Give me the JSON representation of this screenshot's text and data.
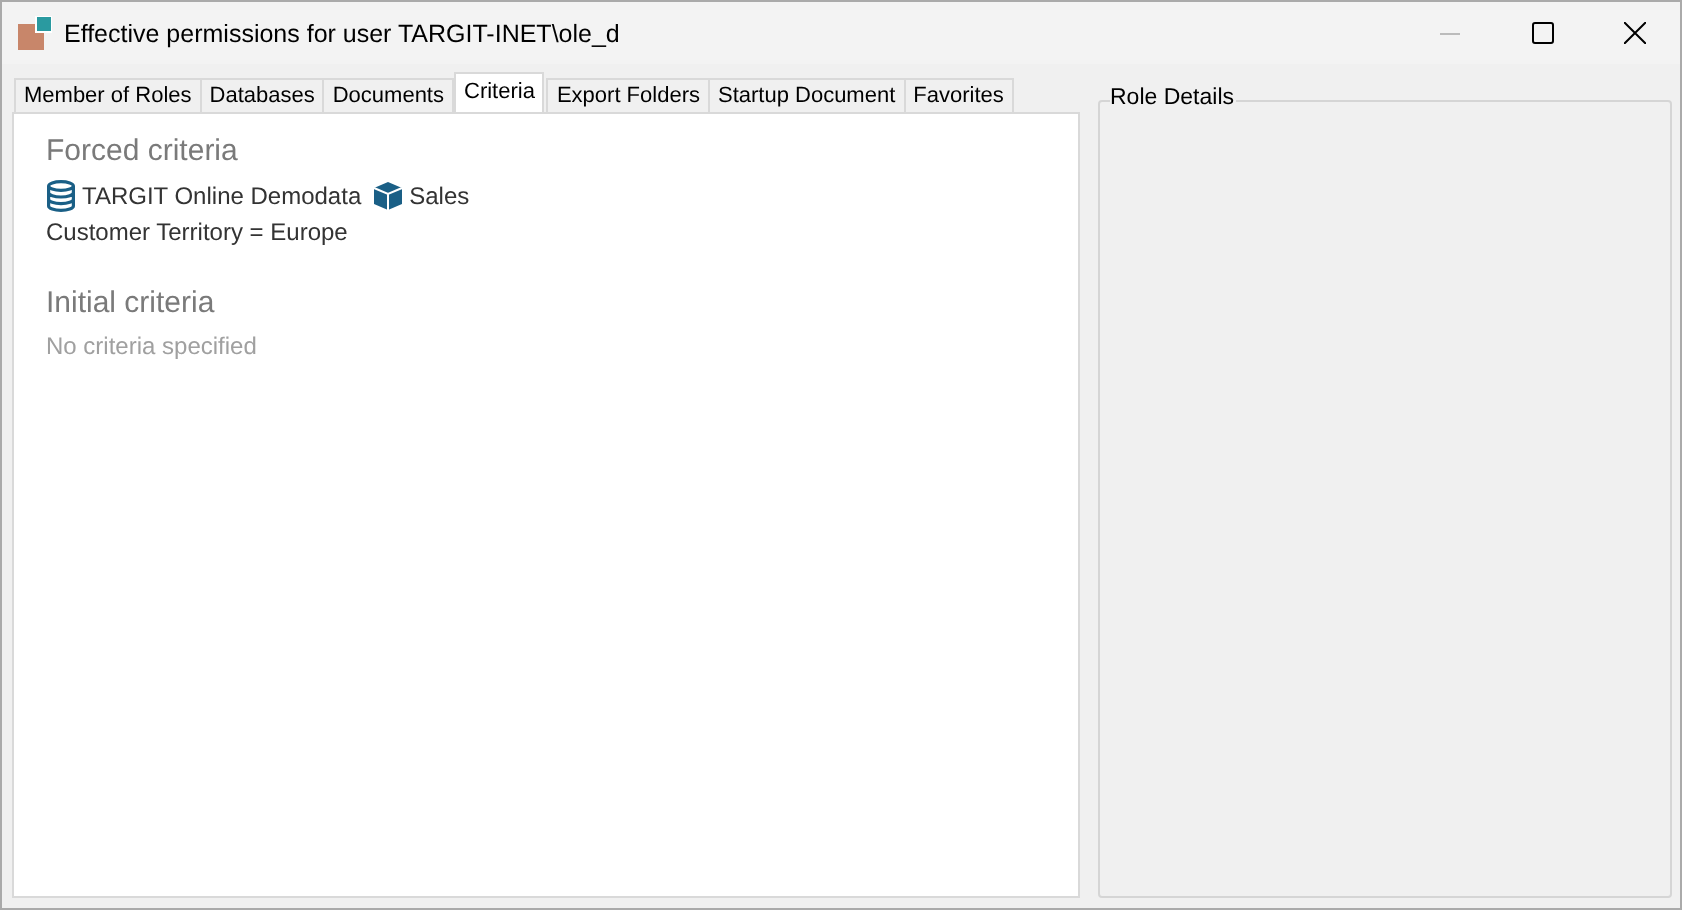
{
  "window": {
    "title": "Effective permissions for user TARGIT-INET\\ole_d"
  },
  "tabs": [
    {
      "label": "Member of Roles",
      "selected": false
    },
    {
      "label": "Databases",
      "selected": false
    },
    {
      "label": "Documents",
      "selected": false
    },
    {
      "label": "Criteria",
      "selected": true
    },
    {
      "label": "Export Folders",
      "selected": false
    },
    {
      "label": "Startup Document",
      "selected": false
    },
    {
      "label": "Favorites",
      "selected": false
    }
  ],
  "criteria": {
    "forced": {
      "heading": "Forced criteria",
      "database": "TARGIT Online Demodata",
      "cube": "Sales",
      "filter": "Customer Territory = Europe"
    },
    "initial": {
      "heading": "Initial criteria",
      "empty_message": "No criteria specified"
    }
  },
  "role_details": {
    "title": "Role Details"
  }
}
